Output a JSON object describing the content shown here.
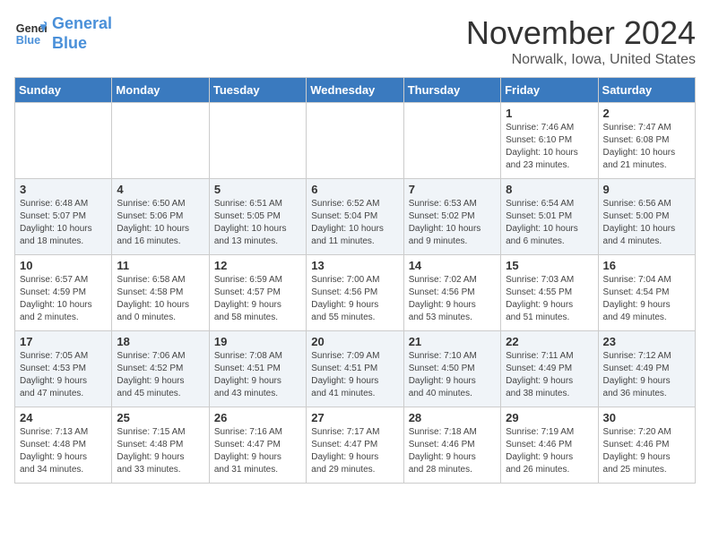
{
  "logo": {
    "line1": "General",
    "line2": "Blue"
  },
  "title": "November 2024",
  "location": "Norwalk, Iowa, United States",
  "weekdays": [
    "Sunday",
    "Monday",
    "Tuesday",
    "Wednesday",
    "Thursday",
    "Friday",
    "Saturday"
  ],
  "weeks": [
    [
      {
        "day": "",
        "info": ""
      },
      {
        "day": "",
        "info": ""
      },
      {
        "day": "",
        "info": ""
      },
      {
        "day": "",
        "info": ""
      },
      {
        "day": "",
        "info": ""
      },
      {
        "day": "1",
        "info": "Sunrise: 7:46 AM\nSunset: 6:10 PM\nDaylight: 10 hours\nand 23 minutes."
      },
      {
        "day": "2",
        "info": "Sunrise: 7:47 AM\nSunset: 6:08 PM\nDaylight: 10 hours\nand 21 minutes."
      }
    ],
    [
      {
        "day": "3",
        "info": "Sunrise: 6:48 AM\nSunset: 5:07 PM\nDaylight: 10 hours\nand 18 minutes."
      },
      {
        "day": "4",
        "info": "Sunrise: 6:50 AM\nSunset: 5:06 PM\nDaylight: 10 hours\nand 16 minutes."
      },
      {
        "day": "5",
        "info": "Sunrise: 6:51 AM\nSunset: 5:05 PM\nDaylight: 10 hours\nand 13 minutes."
      },
      {
        "day": "6",
        "info": "Sunrise: 6:52 AM\nSunset: 5:04 PM\nDaylight: 10 hours\nand 11 minutes."
      },
      {
        "day": "7",
        "info": "Sunrise: 6:53 AM\nSunset: 5:02 PM\nDaylight: 10 hours\nand 9 minutes."
      },
      {
        "day": "8",
        "info": "Sunrise: 6:54 AM\nSunset: 5:01 PM\nDaylight: 10 hours\nand 6 minutes."
      },
      {
        "day": "9",
        "info": "Sunrise: 6:56 AM\nSunset: 5:00 PM\nDaylight: 10 hours\nand 4 minutes."
      }
    ],
    [
      {
        "day": "10",
        "info": "Sunrise: 6:57 AM\nSunset: 4:59 PM\nDaylight: 10 hours\nand 2 minutes."
      },
      {
        "day": "11",
        "info": "Sunrise: 6:58 AM\nSunset: 4:58 PM\nDaylight: 10 hours\nand 0 minutes."
      },
      {
        "day": "12",
        "info": "Sunrise: 6:59 AM\nSunset: 4:57 PM\nDaylight: 9 hours\nand 58 minutes."
      },
      {
        "day": "13",
        "info": "Sunrise: 7:00 AM\nSunset: 4:56 PM\nDaylight: 9 hours\nand 55 minutes."
      },
      {
        "day": "14",
        "info": "Sunrise: 7:02 AM\nSunset: 4:56 PM\nDaylight: 9 hours\nand 53 minutes."
      },
      {
        "day": "15",
        "info": "Sunrise: 7:03 AM\nSunset: 4:55 PM\nDaylight: 9 hours\nand 51 minutes."
      },
      {
        "day": "16",
        "info": "Sunrise: 7:04 AM\nSunset: 4:54 PM\nDaylight: 9 hours\nand 49 minutes."
      }
    ],
    [
      {
        "day": "17",
        "info": "Sunrise: 7:05 AM\nSunset: 4:53 PM\nDaylight: 9 hours\nand 47 minutes."
      },
      {
        "day": "18",
        "info": "Sunrise: 7:06 AM\nSunset: 4:52 PM\nDaylight: 9 hours\nand 45 minutes."
      },
      {
        "day": "19",
        "info": "Sunrise: 7:08 AM\nSunset: 4:51 PM\nDaylight: 9 hours\nand 43 minutes."
      },
      {
        "day": "20",
        "info": "Sunrise: 7:09 AM\nSunset: 4:51 PM\nDaylight: 9 hours\nand 41 minutes."
      },
      {
        "day": "21",
        "info": "Sunrise: 7:10 AM\nSunset: 4:50 PM\nDaylight: 9 hours\nand 40 minutes."
      },
      {
        "day": "22",
        "info": "Sunrise: 7:11 AM\nSunset: 4:49 PM\nDaylight: 9 hours\nand 38 minutes."
      },
      {
        "day": "23",
        "info": "Sunrise: 7:12 AM\nSunset: 4:49 PM\nDaylight: 9 hours\nand 36 minutes."
      }
    ],
    [
      {
        "day": "24",
        "info": "Sunrise: 7:13 AM\nSunset: 4:48 PM\nDaylight: 9 hours\nand 34 minutes."
      },
      {
        "day": "25",
        "info": "Sunrise: 7:15 AM\nSunset: 4:48 PM\nDaylight: 9 hours\nand 33 minutes."
      },
      {
        "day": "26",
        "info": "Sunrise: 7:16 AM\nSunset: 4:47 PM\nDaylight: 9 hours\nand 31 minutes."
      },
      {
        "day": "27",
        "info": "Sunrise: 7:17 AM\nSunset: 4:47 PM\nDaylight: 9 hours\nand 29 minutes."
      },
      {
        "day": "28",
        "info": "Sunrise: 7:18 AM\nSunset: 4:46 PM\nDaylight: 9 hours\nand 28 minutes."
      },
      {
        "day": "29",
        "info": "Sunrise: 7:19 AM\nSunset: 4:46 PM\nDaylight: 9 hours\nand 26 minutes."
      },
      {
        "day": "30",
        "info": "Sunrise: 7:20 AM\nSunset: 4:46 PM\nDaylight: 9 hours\nand 25 minutes."
      }
    ]
  ]
}
